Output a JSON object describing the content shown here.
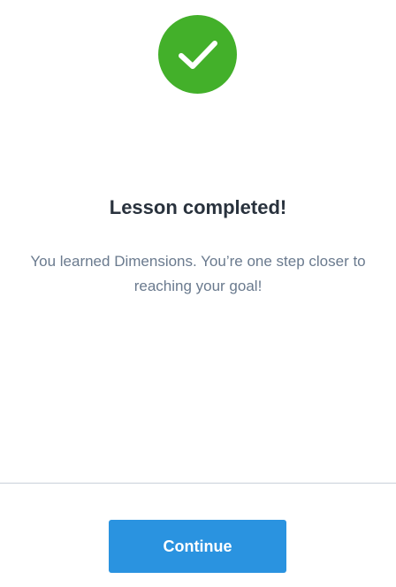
{
  "header": {
    "icon": "checkmark-icon",
    "icon_color": "#43b02a"
  },
  "completion": {
    "title": "Lesson completed!",
    "message": "You learned Dimensions. You’re one step closer to reaching your goal!"
  },
  "footer": {
    "continue_label": "Continue",
    "continue_color": "#2a93e0"
  }
}
